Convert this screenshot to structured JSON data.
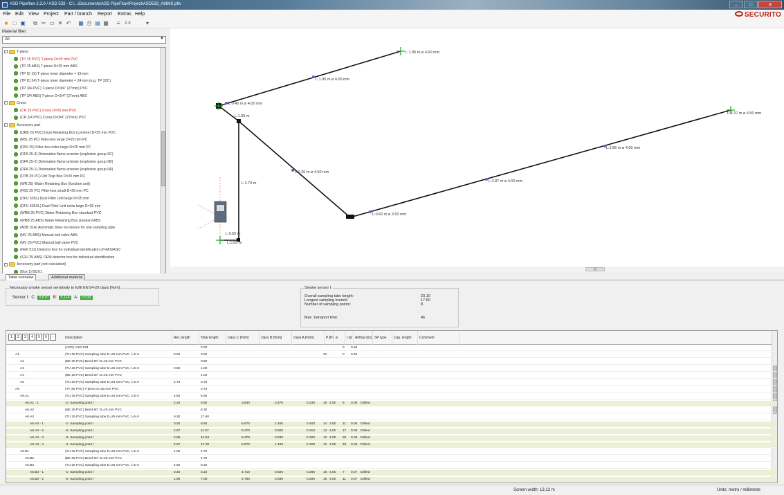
{
  "window": {
    "title": "ASD Pipeflow 2.3.0 / ASD 533 - C:\\...\\Documents\\ASD PipeFlow\\Project\\ASD533_A886K.pfw"
  },
  "logo": {
    "text": "SECURITO"
  },
  "menu": [
    "File",
    "Edit",
    "View",
    "Project",
    "Part / branch",
    "Report",
    "Extras",
    "Help"
  ],
  "toolbar": {
    "zoom_label": "A 8"
  },
  "material_filter": {
    "label": "Material filter:",
    "value": "All"
  },
  "tree": [
    {
      "label": "T-piece",
      "kind": "folder",
      "level": 0
    },
    {
      "label": "(TP 25 PVC) T-piece D=25 mm PVC",
      "kind": "leaf",
      "level": 1,
      "red": true
    },
    {
      "label": "(TP 25 ABS) T-piece D=25 mm ABS",
      "kind": "leaf",
      "level": 1
    },
    {
      "label": "(TP ID 19) T-piece inner diameter = 19 mm",
      "kind": "leaf",
      "level": 1
    },
    {
      "label": "(TP ID 24) T-piece inner diameter = 24 mm (e.g. TP 32C)",
      "kind": "leaf",
      "level": 1
    },
    {
      "label": "(TP 3/4 PVC) T-piece D=3/4\" (27mm) PVC",
      "kind": "leaf",
      "level": 1
    },
    {
      "label": "(TP 3/4 ABS) T-piece D=3/4\" (27mm) ABS",
      "kind": "leaf",
      "level": 1
    },
    {
      "label": "Cross",
      "kind": "folder",
      "level": 0
    },
    {
      "label": "(CR 25 PVC) Cross D=25 mm PVC",
      "kind": "leaf",
      "level": 1,
      "red": true
    },
    {
      "label": "(CR 3/4 PVC) Cross D=3/4\" (27mm) PVC",
      "kind": "leaf",
      "level": 1
    },
    {
      "label": "Accessory part",
      "kind": "folder",
      "level": 0
    },
    {
      "label": "(DRB 25 PVC) Dust Retaining Box (cyclone) D=25 mm PVC",
      "kind": "leaf",
      "level": 1
    },
    {
      "label": "(FBL 25 PC) Filter-box large D=25 mm PC",
      "kind": "leaf",
      "level": 1
    },
    {
      "label": "(FBX 25) Filter-box extra large D=25 mm PC",
      "kind": "leaf",
      "level": 1
    },
    {
      "label": "(DFA 25-3) Detonation flame arrester (explosion group IIC)",
      "kind": "leaf",
      "level": 1
    },
    {
      "label": "(DFA 25-2) Detonation flame arrester (explosion group IIB)",
      "kind": "leaf",
      "level": 1
    },
    {
      "label": "(DFA 25-1) Detonation flame arrester (explosion group IIA)",
      "kind": "leaf",
      "level": 1
    },
    {
      "label": "(DTB 25 PC) Dirt Trap Box D=25 mm PC",
      "kind": "leaf",
      "level": 1
    },
    {
      "label": "(WR 25) Water Retaining Box (function unit)",
      "kind": "leaf",
      "level": 1
    },
    {
      "label": "(FBS 25 PC) Filter-box small D=25 mm PC",
      "kind": "leaf",
      "level": 1
    },
    {
      "label": "(DFU 535L) Dust Filter Unit large D=25 mm",
      "kind": "leaf",
      "level": 1
    },
    {
      "label": "(DFU 535XL) Dust Filter Unit extra large D=25 mm",
      "kind": "leaf",
      "level": 1
    },
    {
      "label": "(WRB 25 PVC) Water Retaining Box standard PVC",
      "kind": "leaf",
      "level": 1
    },
    {
      "label": "(WRB 25 ABS) Water Retaining Box standard ABS",
      "kind": "leaf",
      "level": 1
    },
    {
      "label": "(ADB 01A) Automatic blow out device for one sampling pipe",
      "kind": "leaf",
      "level": 1
    },
    {
      "label": "(MV 25 ABS) Manual ball valve ABS",
      "kind": "leaf",
      "level": 1
    },
    {
      "label": "(MV 25 PVC) Manual ball valve PVC",
      "kind": "leaf",
      "level": 1
    },
    {
      "label": "(FEK 511) Detector box for individual identification of RAS/ASD",
      "kind": "leaf",
      "level": 1
    },
    {
      "label": "(S2H 25 ABS) OEM detector box for individual identification",
      "kind": "leaf",
      "level": 1
    },
    {
      "label": "Accessory part (not calculated)",
      "kind": "folder",
      "level": 0
    },
    {
      "label": "(Box 1) BOX1",
      "kind": "leaf",
      "level": 1
    }
  ],
  "canvas": {
    "labels": [
      "L:1.95 m ø 4.60 mm",
      "L:1.95 m ø 4.00 mm",
      "L:0.40 m ø 4.00 mm",
      "L:1.00 m",
      "L:2.37 m ø 4.50 mm",
      "L:2.86 m ø 4.00 mm",
      "L:2.20 m ø 4.50 mm",
      "L:2.87 m ø 4.00 mm",
      "L:2.70 m",
      "L:0.60 m ø 3.50 mm",
      "L:0.60 m",
      "L:0.50 m"
    ]
  },
  "tabs": [
    "Table overview",
    "Additional material"
  ],
  "sensitivity": {
    "caption": "Necessary smoke sensor sensitivity to fulfil EN 54-20 class [%/m]:",
    "sensor_label": "Sensor I:",
    "c_label": "C:",
    "c_value": "0.670",
    "b_label": "B:",
    "b_value": "0.114",
    "a_label": "A:",
    "a_value": "0.030"
  },
  "smoke_sensor": {
    "caption": "Smoke sensor I:",
    "rows": [
      {
        "k": "Overall sampling tube length:",
        "v": "23.10"
      },
      {
        "k": "Longest sampling branch:",
        "v": "17.60"
      },
      {
        "k": "Number of sampling points:",
        "v": "8"
      },
      {
        "k": "Max. transport time:",
        "v": "46"
      }
    ]
  },
  "grid": {
    "level_buttons": [
      "1",
      "2",
      "3",
      "4",
      "5",
      "6",
      "-"
    ],
    "columns": [
      "Description",
      "Rel. length",
      "Total length",
      "class C [%/m]",
      "class B [%/m]",
      "class A [%/m]",
      "P [Pa]",
      "ø",
      "t [s]",
      "Airflow [l/s]",
      "SP type",
      "Cap. length",
      "Comment"
    ],
    "rows": [
      {
        "id": "",
        "desc": "(ASD) ASD 533",
        "rel": "",
        "tot": "0.00",
        "c": "",
        "b": "",
        "a": "",
        "p": "",
        "d": "",
        "t": "0",
        "af": "0.50",
        "sp": "",
        "hl": false,
        "ind": 0
      },
      {
        "id": "A1",
        "desc": "(TU 25 PVC) Sampling tube D=25 mm PVC, l=5 m",
        "rel": "0.50",
        "tot": "0.50",
        "c": "",
        "b": "",
        "a": "",
        "p": "22",
        "d": "",
        "t": "0",
        "af": "0.50",
        "sp": "",
        "hl": false,
        "ind": 1
      },
      {
        "id": "A2",
        "desc": "(BE 25 PVC) Bend 90° D=25 mm PVC",
        "rel": "",
        "tot": "0.50",
        "c": "",
        "b": "",
        "a": "",
        "p": "",
        "d": "",
        "t": "",
        "af": "",
        "sp": "",
        "hl": false,
        "ind": 2
      },
      {
        "id": "A3",
        "desc": "(TU 25 PVC) Sampling tube D=25 mm PVC, l=5 m",
        "rel": "0.50",
        "tot": "1.00",
        "c": "",
        "b": "",
        "a": "",
        "p": "",
        "d": "",
        "t": "",
        "af": "",
        "sp": "",
        "hl": false,
        "ind": 2
      },
      {
        "id": "A4",
        "desc": "(BE 25 PVC) Bend 90° D=25 mm PVC",
        "rel": "",
        "tot": "1.00",
        "c": "",
        "b": "",
        "a": "",
        "p": "",
        "d": "",
        "t": "",
        "af": "",
        "sp": "",
        "hl": false,
        "ind": 2
      },
      {
        "id": "A5",
        "desc": "(TU 25 PVC) Sampling tube D=25 mm PVC, l=5 m",
        "rel": "2.70",
        "tot": "3.70",
        "c": "",
        "b": "",
        "a": "",
        "p": "",
        "d": "",
        "t": "",
        "af": "",
        "sp": "",
        "hl": false,
        "ind": 2
      },
      {
        "id": "A6",
        "desc": "(TP 25 PVC) T-piece D=25 mm PVC",
        "rel": "",
        "tot": "3.70",
        "c": "",
        "b": "",
        "a": "",
        "p": "",
        "d": "",
        "t": "",
        "af": "",
        "sp": "",
        "hl": false,
        "ind": 1
      },
      {
        "id": "A6.A1",
        "desc": "(TU 25 PVC) Sampling tube D=25 mm PVC, l=5 m",
        "rel": "4.60",
        "tot": "8.30",
        "c": "",
        "b": "",
        "a": "",
        "p": "",
        "d": "",
        "t": "",
        "af": "",
        "sp": "",
        "hl": false,
        "ind": 2
      },
      {
        "id": "A6.A1 - 1",
        "desc": "-1- Sampling point /",
        "rel": "2.20",
        "tot": "5.90",
        "c": "3.840",
        "b": "0.470",
        "a": "0.230",
        "p": "15",
        "d": "4.50",
        "t": "6",
        "af": "0.09",
        "sp": "Drilled",
        "hl": true,
        "ind": 3
      },
      {
        "id": "A6.A2",
        "desc": "(BE 25 PVC) Bend 90° D=25 mm PVC",
        "rel": "",
        "tot": "8.30",
        "c": "",
        "b": "",
        "a": "",
        "p": "",
        "d": "",
        "t": "",
        "af": "",
        "sp": "",
        "hl": false,
        "ind": 3
      },
      {
        "id": "A6.A3",
        "desc": "(TU 25 PVC) Sampling tube D=25 mm PVC, l=5 m",
        "rel": "9.30",
        "tot": "17.60",
        "c": "",
        "b": "",
        "a": "",
        "p": "",
        "d": "",
        "t": "",
        "af": "",
        "sp": "",
        "hl": false,
        "ind": 3
      },
      {
        "id": "A6.A3 - 1",
        "desc": "-1- Sampling point /",
        "rel": "0.50",
        "tot": "8.80",
        "c": "6.670",
        "b": "1.160",
        "a": "0.400",
        "p": "14",
        "d": "3.50",
        "t": "11",
        "af": "0.05",
        "sp": "Drilled",
        "hl": true,
        "ind": 4
      },
      {
        "id": "A6.A3 - 2",
        "desc": "-2- Sampling point /",
        "rel": "2.87",
        "tot": "11.67",
        "c": "5.270",
        "b": "0.920",
        "a": "0.310",
        "p": "13",
        "d": "4.00",
        "t": "17",
        "af": "0.05",
        "sp": "Drilled",
        "hl": true,
        "ind": 4
      },
      {
        "id": "A6.A3 - 3",
        "desc": "-3- Sampling point /",
        "rel": "2.86",
        "tot": "14.53",
        "c": "5.370",
        "b": "0.930",
        "a": "0.320",
        "p": "12",
        "d": "4.00",
        "t": "26",
        "af": "0.06",
        "sp": "Drilled",
        "hl": true,
        "ind": 4
      },
      {
        "id": "A6.A3 - 4",
        "desc": "-4- Sampling point /",
        "rel": "2.87",
        "tot": "17.40",
        "c": "6.670",
        "b": "1.160",
        "a": "0.400",
        "p": "12",
        "d": "4.50",
        "t": "46",
        "af": "0.05",
        "sp": "Drilled",
        "hl": true,
        "ind": 4
      },
      {
        "id": "A6.B1",
        "desc": "(TU 25 PVC) Sampling tube D=25 mm PVC, l=5 m",
        "rel": "1.00",
        "tot": "4.70",
        "c": "",
        "b": "",
        "a": "",
        "p": "",
        "d": "",
        "t": "",
        "af": "",
        "sp": "",
        "hl": false,
        "ind": 2
      },
      {
        "id": "A6.B2",
        "desc": "(BE 25 PVC) Bend 90° D=25 mm PVC",
        "rel": "",
        "tot": "4.70",
        "c": "",
        "b": "",
        "a": "",
        "p": "",
        "d": "",
        "t": "",
        "af": "",
        "sp": "",
        "hl": false,
        "ind": 3
      },
      {
        "id": "A6.B3",
        "desc": "(TU 25 PVC) Sampling tube D=25 mm PVC, l=5 m",
        "rel": "4.50",
        "tot": "9.20",
        "c": "",
        "b": "",
        "a": "",
        "p": "",
        "d": "",
        "t": "",
        "af": "",
        "sp": "",
        "hl": false,
        "ind": 3
      },
      {
        "id": "A6.B3 - 1",
        "desc": "-1- Sampling point /",
        "rel": "0.40",
        "tot": "5.10",
        "c": "4.710",
        "b": "0.820",
        "a": "0.280",
        "p": "16",
        "d": "4.00",
        "t": "7",
        "af": "0.07",
        "sp": "Drilled",
        "hl": true,
        "ind": 4
      },
      {
        "id": "A6.B3 - 2",
        "desc": "-2- Sampling point /",
        "rel": "1.95",
        "tot": "7.05",
        "c": "4.780",
        "b": "0.830",
        "a": "0.280",
        "p": "16",
        "d": "4.00",
        "t": "11",
        "af": "0.07",
        "sp": "Drilled",
        "hl": true,
        "ind": 4
      }
    ]
  },
  "status": {
    "screen_width": "Screen width: 13.12 m",
    "units": "Units: metre / millimetre"
  }
}
